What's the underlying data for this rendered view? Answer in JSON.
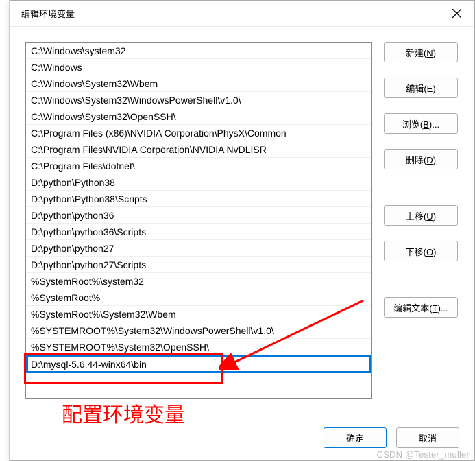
{
  "titlebar": {
    "title": "编辑环境变量"
  },
  "list": {
    "items": [
      "C:\\Windows\\system32",
      "C:\\Windows",
      "C:\\Windows\\System32\\Wbem",
      "C:\\Windows\\System32\\WindowsPowerShell\\v1.0\\",
      "C:\\Windows\\System32\\OpenSSH\\",
      "C:\\Program Files (x86)\\NVIDIA Corporation\\PhysX\\Common",
      "C:\\Program Files\\NVIDIA Corporation\\NVIDIA NvDLISR",
      "C:\\Program Files\\dotnet\\",
      "D:\\python\\Python38",
      "D:\\python\\Python38\\Scripts",
      "D:\\python\\python36",
      "D:\\python\\python36\\Scripts",
      "D:\\python\\python27",
      "D:\\python\\python27\\Scripts",
      "%SystemRoot%\\system32",
      "%SystemRoot%",
      "%SystemRoot%\\System32\\Wbem",
      "%SYSTEMROOT%\\System32\\WindowsPowerShell\\v1.0\\",
      "%SYSTEMROOT%\\System32\\OpenSSH\\"
    ],
    "editing_value": "D:\\mysql-5.6.44-winx64\\bin"
  },
  "buttons": {
    "new": "新建(N)",
    "edit": "编辑(E)",
    "browse": "浏览(B)...",
    "delete": "删除(D)",
    "move_up": "上移(U)",
    "move_down": "下移(O)",
    "edit_text": "编辑文本(T)...",
    "ok": "确定",
    "cancel": "取消"
  },
  "annotation": {
    "label": "配置环境变量"
  },
  "watermark": {
    "text": "CSDN @Tester_muller"
  }
}
